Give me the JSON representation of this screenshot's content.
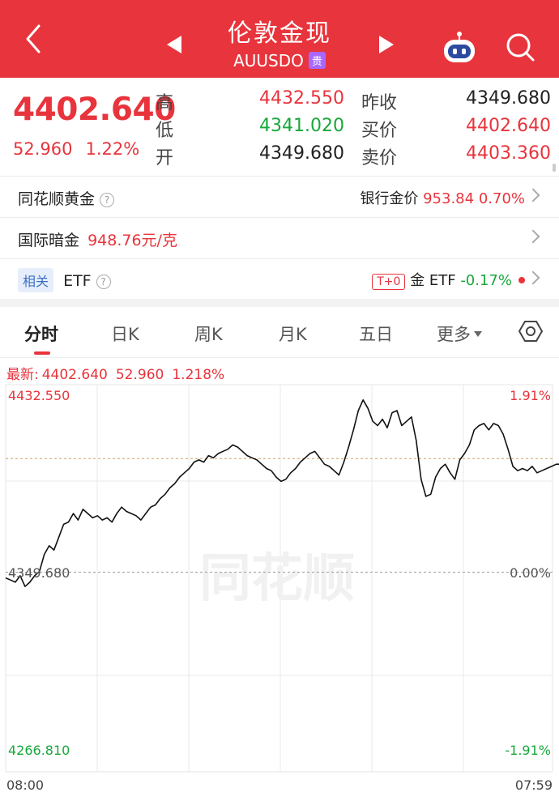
{
  "header": {
    "title": "伦敦金现",
    "code": "AUUSDO",
    "badge": "贵",
    "colors": {
      "bg": "#e8343c"
    }
  },
  "quote": {
    "price": "4402.640",
    "change": "52.960",
    "change_pct": "1.22%",
    "high_label": "高",
    "high": "4432.550",
    "low_label": "低",
    "low": "4341.020",
    "open_label": "开",
    "open": "4349.680",
    "prev_close_label": "昨收",
    "prev_close": "4349.680",
    "bid_label": "买价",
    "bid": "4402.640",
    "ask_label": "卖价",
    "ask": "4403.360"
  },
  "rows": {
    "ths_gold": "同花顺黄金",
    "help_glyph": "?",
    "bank_gold_label": "银行金价",
    "bank_gold_value": "953.84",
    "bank_gold_pct": "0.70%",
    "intl_dark_label": "国际暗金",
    "intl_dark_value": "948.76元/克",
    "related_tag": "相关",
    "etf_label": "ETF",
    "t0_tag": "T+0",
    "gold_etf_label": "金 ETF",
    "gold_etf_pct": "-0.17%"
  },
  "tabs": {
    "items": [
      "分时",
      "日K",
      "周K",
      "月K",
      "五日",
      "更多"
    ],
    "active": "分时"
  },
  "latest_bar": {
    "label": "最新:",
    "price": "4402.640",
    "change": "52.960",
    "pct": "1.218%"
  },
  "chart_data": {
    "type": "line",
    "y_labels": {
      "top": "4432.550",
      "mid": "4349.680",
      "bottom": "4266.810"
    },
    "pct_labels": {
      "top": "1.91%",
      "mid": "0.00%",
      "bottom": "-1.91%"
    },
    "x_labels": {
      "start": "08:00",
      "end": "07:59"
    },
    "ylim": [
      4266.81,
      4432.55
    ],
    "reference_price": 4349.68,
    "current_price": 4402.64,
    "watermark": "同花顺",
    "colors": {
      "line": "#111111",
      "up": "#e8343c",
      "down": "#17a83b",
      "ref": "#cfa060"
    },
    "points": [
      [
        0,
        4347
      ],
      [
        1,
        4346
      ],
      [
        2,
        4345
      ],
      [
        3,
        4348
      ],
      [
        4,
        4343
      ],
      [
        5,
        4345
      ],
      [
        6,
        4348
      ],
      [
        7,
        4350
      ],
      [
        8,
        4358
      ],
      [
        9,
        4362
      ],
      [
        10,
        4360
      ],
      [
        11,
        4366
      ],
      [
        12,
        4372
      ],
      [
        13,
        4373
      ],
      [
        14,
        4377
      ],
      [
        15,
        4374
      ],
      [
        16,
        4379
      ],
      [
        17,
        4377
      ],
      [
        18,
        4375
      ],
      [
        19,
        4376
      ],
      [
        20,
        4374
      ],
      [
        21,
        4375
      ],
      [
        22,
        4373
      ],
      [
        23,
        4377
      ],
      [
        24,
        4380
      ],
      [
        25,
        4378
      ],
      [
        26,
        4377
      ],
      [
        27,
        4376
      ],
      [
        28,
        4374
      ],
      [
        29,
        4377
      ],
      [
        30,
        4380
      ],
      [
        31,
        4381
      ],
      [
        32,
        4384
      ],
      [
        33,
        4386
      ],
      [
        34,
        4389
      ],
      [
        35,
        4391
      ],
      [
        36,
        4394
      ],
      [
        37,
        4396
      ],
      [
        38,
        4398
      ],
      [
        39,
        4401
      ],
      [
        40,
        4402
      ],
      [
        41,
        4401
      ],
      [
        42,
        4404
      ],
      [
        43,
        4403
      ],
      [
        44,
        4405
      ],
      [
        45,
        4406
      ],
      [
        46,
        4407
      ],
      [
        47,
        4409
      ],
      [
        48,
        4408
      ],
      [
        49,
        4406
      ],
      [
        50,
        4404
      ],
      [
        51,
        4403
      ],
      [
        52,
        4402
      ],
      [
        53,
        4400
      ],
      [
        54,
        4398
      ],
      [
        55,
        4397
      ],
      [
        56,
        4394
      ],
      [
        57,
        4392
      ],
      [
        58,
        4393
      ],
      [
        59,
        4396
      ],
      [
        60,
        4398
      ],
      [
        61,
        4401
      ],
      [
        62,
        4403
      ],
      [
        63,
        4405
      ],
      [
        64,
        4406
      ],
      [
        65,
        4403
      ],
      [
        66,
        4400
      ],
      [
        67,
        4399
      ],
      [
        68,
        4397
      ],
      [
        69,
        4395
      ],
      [
        70,
        4401
      ],
      [
        71,
        4408
      ],
      [
        72,
        4416
      ],
      [
        73,
        4425
      ],
      [
        74,
        4430
      ],
      [
        75,
        4426
      ],
      [
        76,
        4420
      ],
      [
        77,
        4418
      ],
      [
        78,
        4421
      ],
      [
        79,
        4417
      ],
      [
        80,
        4424
      ],
      [
        81,
        4425
      ],
      [
        82,
        4418
      ],
      [
        83,
        4420
      ],
      [
        84,
        4422
      ],
      [
        85,
        4411
      ],
      [
        86,
        4393
      ],
      [
        87,
        4385
      ],
      [
        88,
        4386
      ],
      [
        89,
        4394
      ],
      [
        90,
        4398
      ],
      [
        91,
        4400
      ],
      [
        92,
        4396
      ],
      [
        93,
        4393
      ],
      [
        94,
        4402
      ],
      [
        95,
        4405
      ],
      [
        96,
        4409
      ],
      [
        97,
        4416
      ],
      [
        98,
        4418
      ],
      [
        99,
        4419
      ],
      [
        100,
        4416
      ],
      [
        101,
        4419
      ],
      [
        102,
        4418
      ],
      [
        103,
        4414
      ],
      [
        104,
        4407
      ],
      [
        105,
        4399
      ],
      [
        106,
        4397
      ],
      [
        107,
        4398
      ],
      [
        108,
        4397
      ],
      [
        109,
        4399
      ],
      [
        110,
        4396
      ],
      [
        111,
        4397
      ],
      [
        112,
        4398
      ],
      [
        113,
        4399
      ],
      [
        114,
        4400
      ],
      [
        115,
        4400
      ],
      [
        116,
        4401
      ],
      [
        117,
        4401
      ],
      [
        118,
        4401
      ],
      [
        119,
        4401
      ],
      [
        120,
        4401
      ],
      [
        121,
        4401
      ],
      [
        122,
        4404
      ],
      [
        123,
        4402
      ]
    ]
  }
}
